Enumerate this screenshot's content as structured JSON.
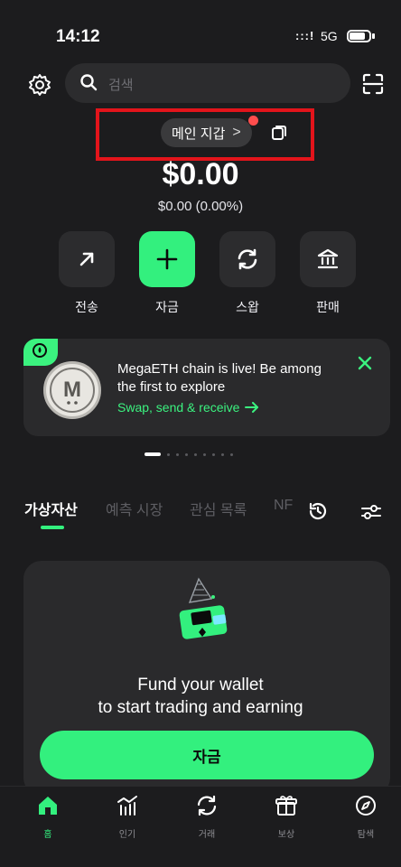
{
  "status_bar": {
    "time": "14:12",
    "network": ":::!",
    "network_type": "5G",
    "battery_percent": 80
  },
  "header": {
    "search": {
      "placeholder": "검색"
    }
  },
  "wallet": {
    "name": "메인 지갑",
    "chevron": ">",
    "balance": "$0.00",
    "change": "$0.00 (0.00%)"
  },
  "actions": [
    {
      "label": "전송",
      "icon": "send-arrow-icon"
    },
    {
      "label": "자금",
      "icon": "plus-icon"
    },
    {
      "label": "스왑",
      "icon": "swap-icon"
    },
    {
      "label": "판매",
      "icon": "bank-icon"
    }
  ],
  "banner": {
    "title": "MegaETH chain is live! Be among the first to explore",
    "cta": "Swap, send & receive",
    "logo_letter": "M",
    "carousel": {
      "total_pages": 9,
      "active_index": 0
    }
  },
  "tabs": [
    {
      "label": "가상자산",
      "active": true
    },
    {
      "label": "예측 시장",
      "active": false
    },
    {
      "label": "관심 목록",
      "active": false
    },
    {
      "label": "NF",
      "active": false
    }
  ],
  "empty_state": {
    "title_line1": "Fund your wallet",
    "title_line2": "to start trading and earning",
    "button": "자금"
  },
  "bottom_nav": [
    {
      "label": "홈",
      "icon": "home-icon",
      "active": true
    },
    {
      "label": "인기",
      "icon": "trending-chart-icon",
      "active": false
    },
    {
      "label": "거래",
      "icon": "trade-swap-icon",
      "active": false
    },
    {
      "label": "보상",
      "icon": "gift-icon",
      "active": false
    },
    {
      "label": "탐색",
      "icon": "compass-icon",
      "active": false
    }
  ],
  "colors": {
    "accent": "#33f07e",
    "background": "#1c1c1e",
    "surface": "#2a2a2c",
    "highlight": "#e3141b"
  }
}
